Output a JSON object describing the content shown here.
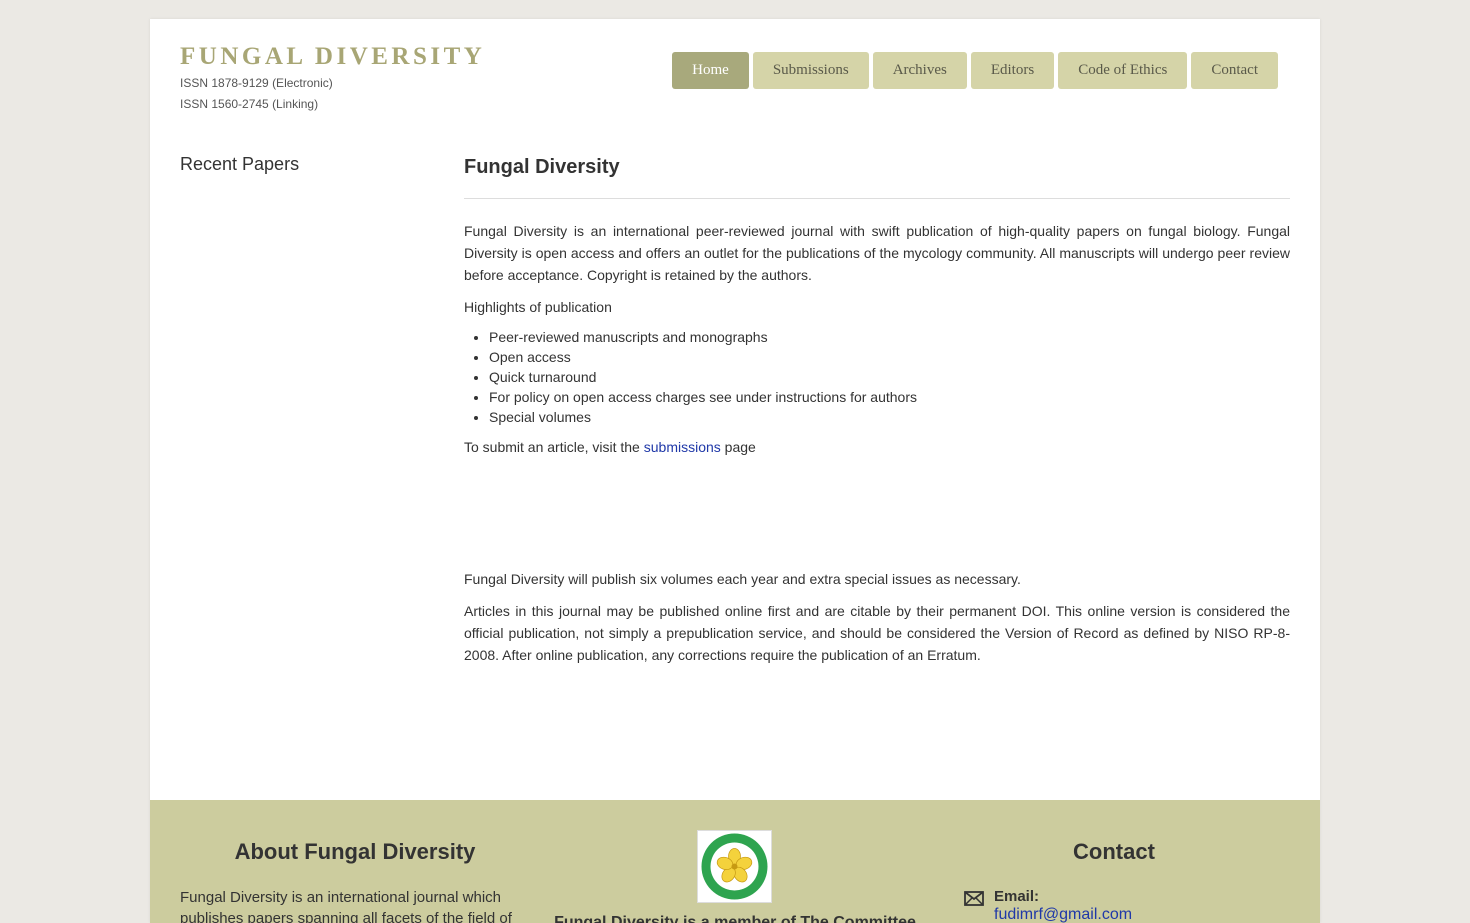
{
  "header": {
    "site_title": "FUNGAL DIVERSITY",
    "issn_electronic": "ISSN 1878-9129 (Electronic)",
    "issn_linking": "ISSN 1560-2745 (Linking)"
  },
  "nav": {
    "items": [
      {
        "label": "Home",
        "active": true
      },
      {
        "label": "Submissions"
      },
      {
        "label": "Archives"
      },
      {
        "label": "Editors"
      },
      {
        "label": "Code of Ethics"
      },
      {
        "label": "Contact"
      }
    ]
  },
  "sidebar": {
    "title": "Recent Papers"
  },
  "content": {
    "title": "Fungal Diversity",
    "intro": "Fungal Diversity is an international peer-reviewed journal with swift publication of high-quality papers on fungal biology.  Fungal Diversity is open access and offers an outlet for the publications of the mycology community.  All manuscripts will undergo peer review before acceptance. Copyright is retained by the authors.",
    "highlights_heading": "Highlights of publication",
    "highlights": [
      "Peer-reviewed manuscripts and monographs",
      "Open access",
      "Quick turnaround",
      "For policy on open access charges see under instructions for authors",
      "Special volumes"
    ],
    "submit_prefix": "To submit an article, visit the ",
    "submit_link": "submissions",
    "submit_suffix": " page",
    "publish_note": "Fungal Diversity will publish six volumes each year and extra special issues as necessary.",
    "articles_note": "Articles in this journal may be published online first and are citable by their permanent DOI. This online version is considered the official publication, not simply a prepublication service, and should be considered the Version of Record as defined by NISO RP-8-2008. After online publication, any corrections require the publication of an Erratum."
  },
  "footer": {
    "about_title": "About Fungal Diversity",
    "about_text": "Fungal Diversity is an international journal which publishes papers spanning all facets of the field of",
    "member_text": "Fungal Diversity is a member of The Committee",
    "contact_title": "Contact",
    "email_label": "Email:",
    "email": "fudimrf@gmail.com",
    "icons": {
      "mail": "mail-icon",
      "logo": "institute-logo"
    }
  },
  "colors": {
    "accent": "#a8a675",
    "nav_bg": "#d5d4a8",
    "nav_active": "#a8a97c",
    "footer_bg": "#cccc9e",
    "link": "#1f38a8"
  }
}
